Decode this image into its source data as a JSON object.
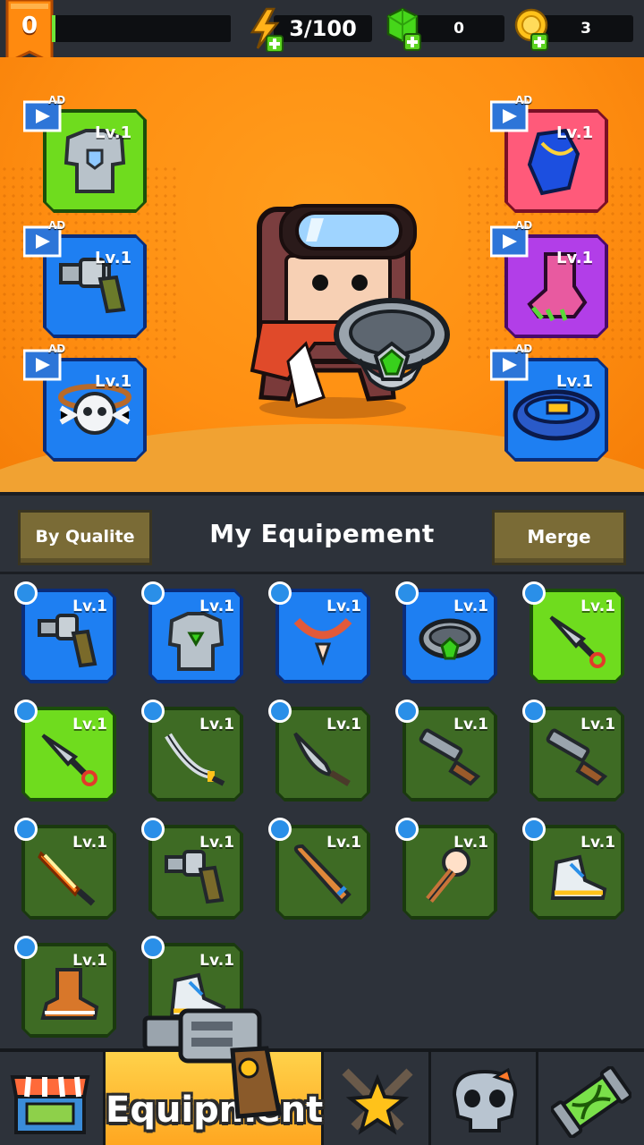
{
  "topbar": {
    "player_level": "0",
    "xp_progress": 0.02,
    "energy": "3/100",
    "gems": "0",
    "gold": "3"
  },
  "hero": {
    "ad_label": "AD",
    "slots": [
      {
        "name": "armor",
        "level": "Lv.1",
        "rarity": "green",
        "icon": "armor-icon"
      },
      {
        "name": "gloves",
        "level": "Lv.1",
        "rarity": "red",
        "icon": "glove-icon"
      },
      {
        "name": "weapon",
        "level": "Lv.1",
        "rarity": "blue",
        "icon": "revolver-icon"
      },
      {
        "name": "boots",
        "level": "Lv.1",
        "rarity": "purple",
        "icon": "boot-icon"
      },
      {
        "name": "necklace",
        "level": "Lv.1",
        "rarity": "blue",
        "icon": "skull-necklace-icon"
      },
      {
        "name": "belt",
        "level": "Lv.1",
        "rarity": "blue",
        "icon": "belt-icon"
      }
    ]
  },
  "equipment_header": {
    "sort_button": "By Qualite",
    "title": "My Equipement",
    "merge_button": "Merge"
  },
  "inventory": [
    {
      "level": "Lv.1",
      "rarity": "blue",
      "icon": "revolver-icon"
    },
    {
      "level": "Lv.1",
      "rarity": "blue",
      "icon": "armor-icon"
    },
    {
      "level": "Lv.1",
      "rarity": "blue",
      "icon": "necklace-icon"
    },
    {
      "level": "Lv.1",
      "rarity": "blue",
      "icon": "ring-icon"
    },
    {
      "level": "Lv.1",
      "rarity": "green",
      "icon": "kunai-icon"
    },
    {
      "level": "Lv.1",
      "rarity": "green",
      "icon": "kunai-icon"
    },
    {
      "level": "Lv.1",
      "rarity": "dark",
      "icon": "katana-icon"
    },
    {
      "level": "Lv.1",
      "rarity": "dark",
      "icon": "machete-icon"
    },
    {
      "level": "Lv.1",
      "rarity": "dark",
      "icon": "shotgun-icon"
    },
    {
      "level": "Lv.1",
      "rarity": "dark",
      "icon": "shotgun-icon"
    },
    {
      "level": "Lv.1",
      "rarity": "dark",
      "icon": "flame-sword-icon"
    },
    {
      "level": "Lv.1",
      "rarity": "dark",
      "icon": "revolver-icon"
    },
    {
      "level": "Lv.1",
      "rarity": "dark",
      "icon": "bat-icon"
    },
    {
      "level": "Lv.1",
      "rarity": "dark",
      "icon": "spiked-bat-icon"
    },
    {
      "level": "Lv.1",
      "rarity": "dark",
      "icon": "sneaker-icon"
    },
    {
      "level": "Lv.1",
      "rarity": "dark",
      "icon": "boot-icon"
    },
    {
      "level": "Lv.1",
      "rarity": "dark",
      "icon": "sneaker-icon"
    }
  ],
  "bottom_nav": {
    "tabs": [
      {
        "name": "shop",
        "icon": "shop-icon"
      },
      {
        "name": "equipment",
        "label": "Equipment",
        "icon": "revolver-icon",
        "active": true
      },
      {
        "name": "battle",
        "icon": "crossed-swords-star-icon"
      },
      {
        "name": "challenge",
        "icon": "skull-icon"
      },
      {
        "name": "evolution",
        "icon": "dna-capsule-icon"
      }
    ]
  },
  "colors": {
    "blue": "#1e7ff2",
    "green": "#6fdc1e",
    "red": "#ff5a7a",
    "purple": "#b23ee8",
    "dark": "#3e6b24",
    "orange_bg": "#ff8f12",
    "panel": "#2d323a"
  }
}
